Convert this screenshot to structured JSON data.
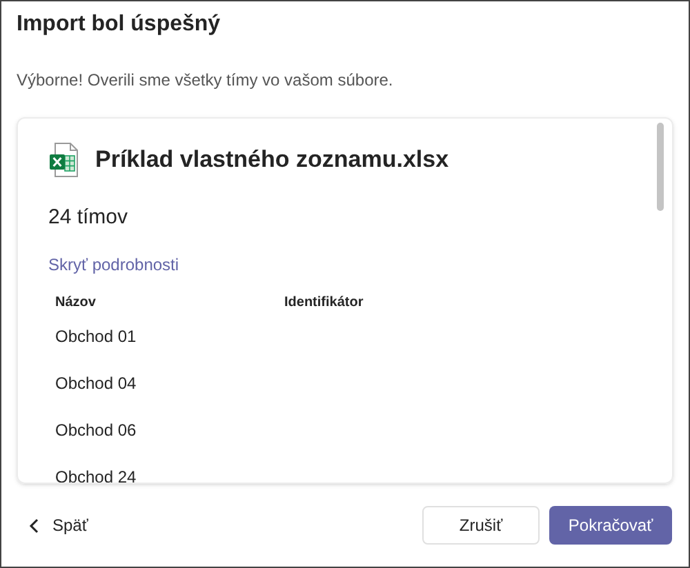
{
  "dialog": {
    "title": "Import bol úspešný",
    "message": "Výborne! Overili sme všetky tímy vo vašom súbore."
  },
  "file": {
    "name": "Príklad vlastného zoznamu.xlsx",
    "count": "24 tímov",
    "toggle_link": "Skryť podrobnosti"
  },
  "table": {
    "columns": [
      "Názov",
      "Identifikátor"
    ],
    "rows": [
      [
        "Obchod 01"
      ],
      [
        "Obchod 04"
      ],
      [
        "Obchod 06"
      ],
      [
        "Obchod 24"
      ]
    ]
  },
  "footer": {
    "back": "Späť",
    "cancel": "Zrušiť",
    "continue": "Pokračovať"
  }
}
